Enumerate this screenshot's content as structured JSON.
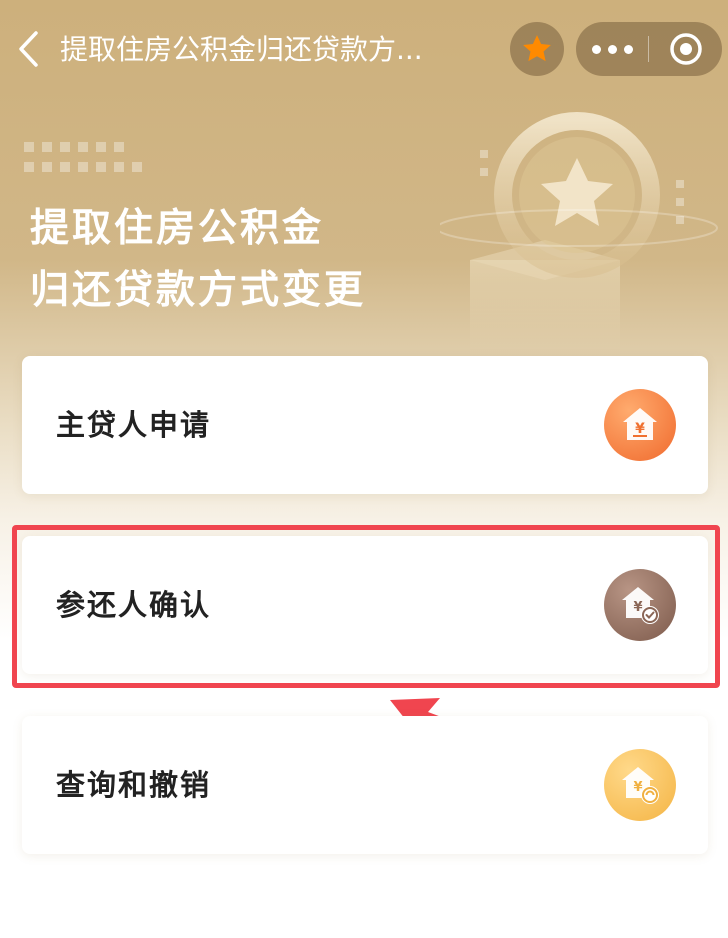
{
  "nav": {
    "title": "提取住房公积金归还贷款方...",
    "back_icon": "chevron-left-icon",
    "favorite_icon": "star-icon",
    "more_icon": "more-dots-icon",
    "close_icon": "target-close-icon"
  },
  "hero": {
    "title_line1": "提取住房公积金",
    "title_line2": "归还贷款方式变更"
  },
  "cards": [
    {
      "label": "主贷人申请",
      "icon": "house-yen-icon",
      "color": "#f5793a"
    },
    {
      "label": "参还人确认",
      "icon": "house-yen-check-icon",
      "color": "#8f6a5c"
    },
    {
      "label": "查询和撤销",
      "icon": "house-yen-search-icon",
      "color": "#f6c056"
    }
  ],
  "colors": {
    "accent_highlight": "#f0454f",
    "favorite_star": "#ff8a00",
    "header_gold": "#cdb07c"
  }
}
